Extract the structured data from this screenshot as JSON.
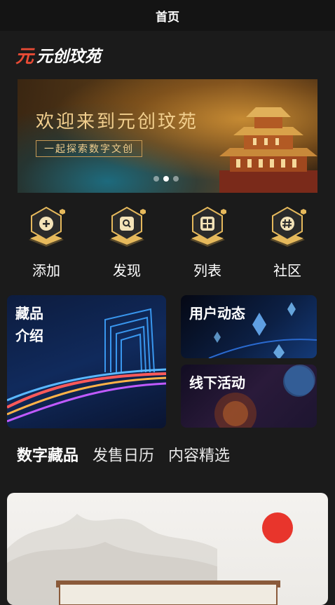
{
  "status_bar": {
    "title": "首页"
  },
  "logo": {
    "mark": "元",
    "text": "元创玟苑"
  },
  "banner": {
    "title": "欢迎来到元创玟苑",
    "subtitle": "一起探索数字文创",
    "dots": 3,
    "active_dot": 1
  },
  "quick_entry": [
    {
      "label": "添加",
      "icon": "plus-icon"
    },
    {
      "label": "发现",
      "icon": "search-icon"
    },
    {
      "label": "列表",
      "icon": "grid-icon"
    },
    {
      "label": "社区",
      "icon": "hash-icon"
    }
  ],
  "cards": {
    "collection": {
      "line1": "藏品",
      "line2": "介绍"
    },
    "user_activity": {
      "title": "用户动态"
    },
    "offline_event": {
      "title": "线下活动"
    }
  },
  "tabs": [
    {
      "label": "数字藏品",
      "active": true
    },
    {
      "label": "发售日历",
      "active": false
    },
    {
      "label": "内容精选",
      "active": false
    }
  ],
  "colors": {
    "background": "#1b1b1b",
    "banner_text": "#f2cf8e",
    "accent_red": "#e94b35",
    "icon_gold": "#e6b95c"
  }
}
